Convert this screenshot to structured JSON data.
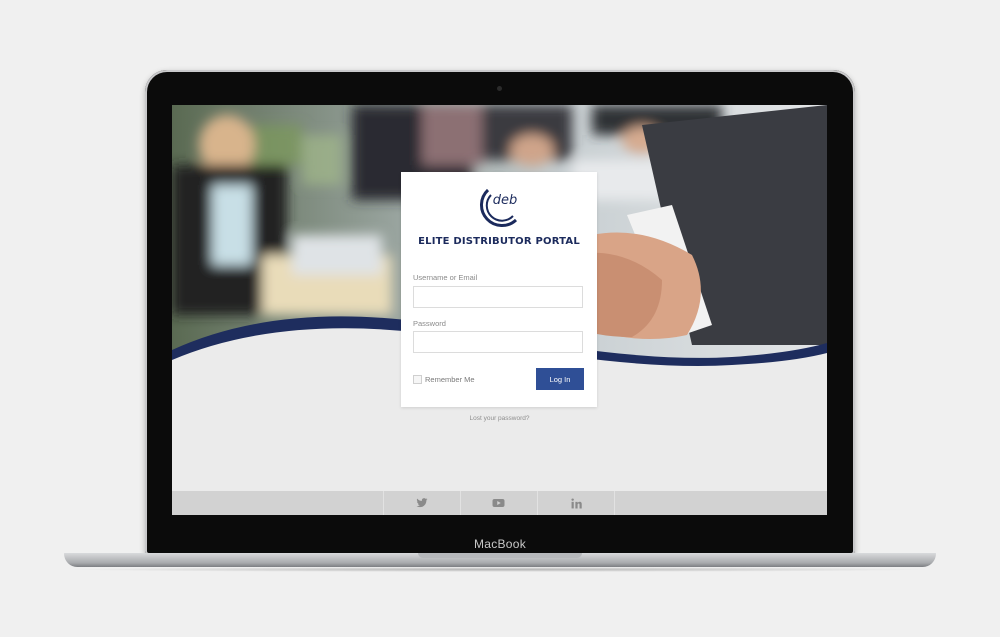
{
  "device": {
    "brand": "MacBook"
  },
  "logo": {
    "text": "deb",
    "tagline": ""
  },
  "login": {
    "title": "ELITE DISTRIBUTOR PORTAL",
    "username_label": "Username or Email",
    "username_value": "",
    "password_label": "Password",
    "password_value": "",
    "remember_label": "Remember Me",
    "remember_checked": false,
    "submit_label": "Log In",
    "lost_password": "Lost your password?"
  },
  "social": [
    {
      "icon": "twitter-icon"
    },
    {
      "icon": "youtube-icon"
    },
    {
      "icon": "linkedin-icon"
    }
  ],
  "colors": {
    "accent": "#2f4f96",
    "navy": "#1b2a5c",
    "wave": "#1e2d5e",
    "background": "#ebebeb"
  }
}
